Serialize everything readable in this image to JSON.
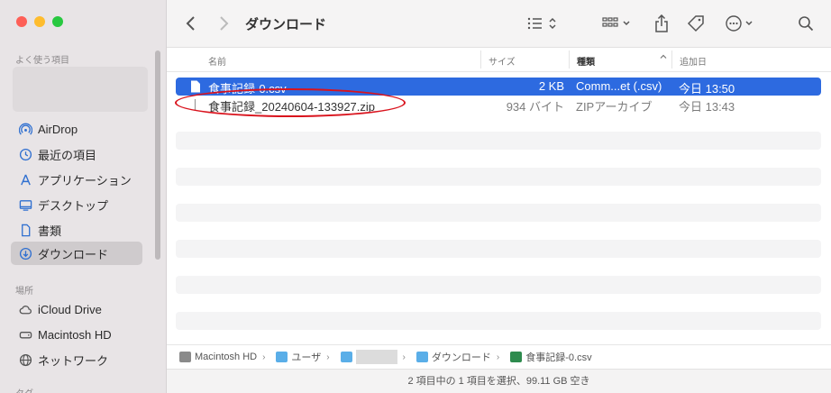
{
  "sidebar": {
    "favorites_label": "よく使う項目",
    "items": [
      {
        "label": "AirDrop",
        "icon": "airdrop-icon"
      },
      {
        "label": "最近の項目",
        "icon": "clock-icon"
      },
      {
        "label": "アプリケーション",
        "icon": "applications-icon"
      },
      {
        "label": "デスクトップ",
        "icon": "desktop-icon"
      },
      {
        "label": "書類",
        "icon": "document-icon"
      },
      {
        "label": "ダウンロード",
        "icon": "download-icon",
        "active": true
      }
    ],
    "locations_label": "場所",
    "locations": [
      {
        "label": "iCloud Drive",
        "icon": "cloud-icon"
      },
      {
        "label": "Macintosh HD",
        "icon": "disk-icon"
      },
      {
        "label": "ネットワーク",
        "icon": "network-icon"
      }
    ],
    "tags_label": "タグ"
  },
  "toolbar": {
    "title": "ダウンロード"
  },
  "columns": {
    "name": "名前",
    "size": "サイズ",
    "kind": "種類",
    "date": "追加日"
  },
  "files": [
    {
      "name": "食事記録-0.csv",
      "size": "2 KB",
      "kind": "Comm...et (.csv)",
      "date": "今日 13:50",
      "selected": true
    },
    {
      "name": "食事記録_20240604-133927.zip",
      "size": "934 バイト",
      "kind": "ZIPアーカイブ",
      "date": "今日 13:43",
      "selected": false
    }
  ],
  "pathbar": {
    "items": [
      "Macintosh HD",
      "ユーザ",
      "",
      "ダウンロード",
      "食事記録-0.csv"
    ]
  },
  "status": {
    "text": "2 項目中の 1 項目を選択、99.11 GB 空き"
  },
  "colors": {
    "accent": "#2d6ae0",
    "highlight": "#d9131d"
  }
}
